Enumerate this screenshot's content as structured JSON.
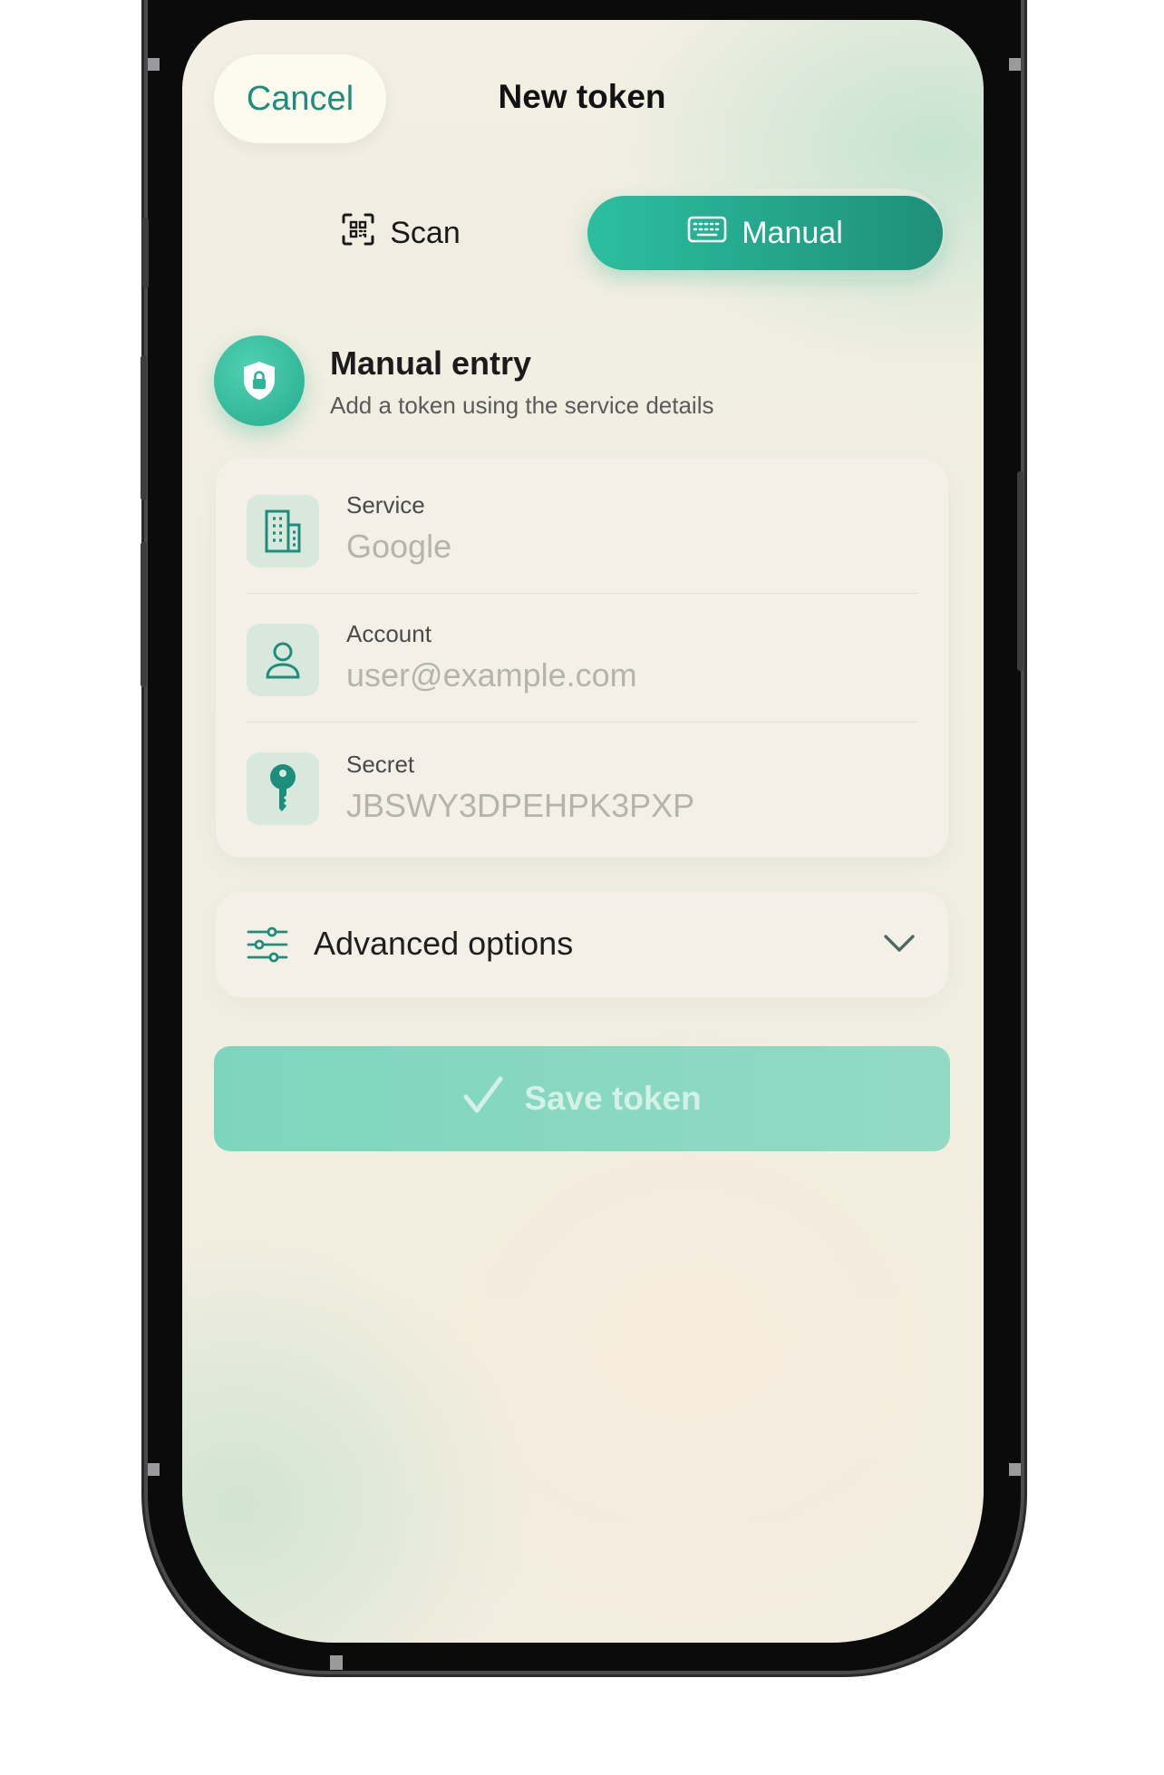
{
  "header": {
    "cancel_label": "Cancel",
    "title": "New token"
  },
  "segmented": {
    "scan_label": "Scan",
    "manual_label": "Manual",
    "selected": "Manual"
  },
  "section": {
    "title": "Manual entry",
    "subtitle": "Add a token using the service details"
  },
  "fields": [
    {
      "label": "Service",
      "placeholder": "Google",
      "icon": "building-icon"
    },
    {
      "label": "Account",
      "placeholder": "user@example.com",
      "icon": "person-icon"
    },
    {
      "label": "Secret",
      "placeholder": "JBSWY3DPEHPK3PXP",
      "icon": "key-icon"
    }
  ],
  "advanced": {
    "label": "Advanced options",
    "icon": "sliders-icon",
    "expanded": false
  },
  "save": {
    "label": "Save token",
    "enabled": false
  },
  "colors": {
    "accent": "#24a98b",
    "accent_dark": "#1e8e7c",
    "save_disabled": "#8ad8c1",
    "icon_tile": "#d9e8dc"
  }
}
